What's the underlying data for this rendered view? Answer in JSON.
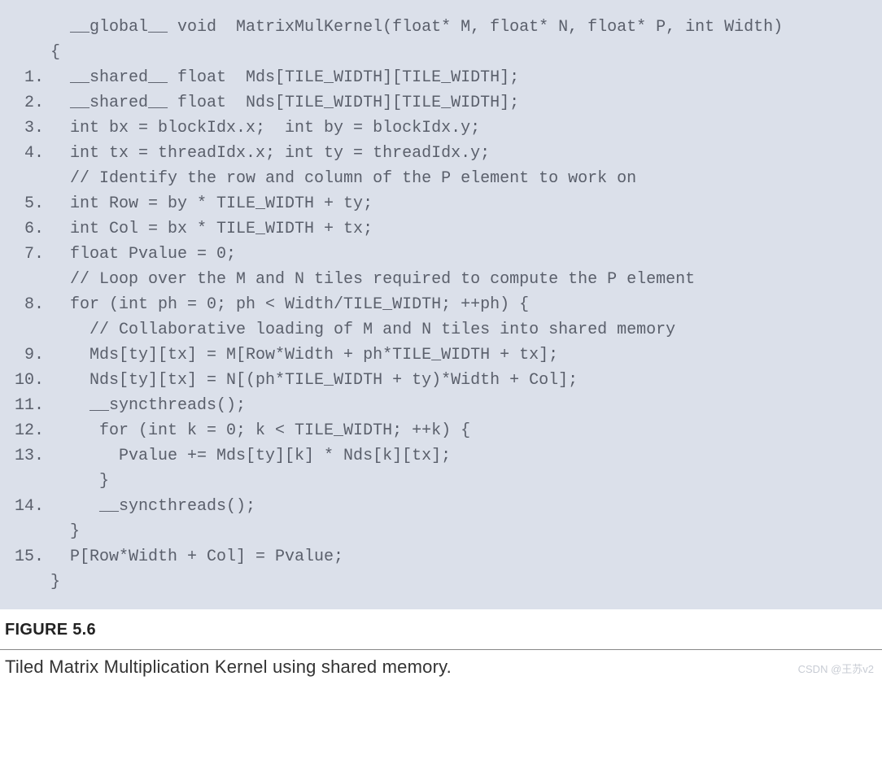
{
  "code": {
    "lines": [
      {
        "num": "",
        "text": "  __global__ void  MatrixMulKernel(float* M, float* N, float* P, int Width)"
      },
      {
        "num": "",
        "text": "{"
      },
      {
        "num": "",
        "text": ""
      },
      {
        "num": "1.",
        "text": "  __shared__ float  Mds[TILE_WIDTH][TILE_WIDTH];"
      },
      {
        "num": "2.",
        "text": "  __shared__ float  Nds[TILE_WIDTH][TILE_WIDTH];"
      },
      {
        "num": "",
        "text": ""
      },
      {
        "num": "3.",
        "text": "  int bx = blockIdx.x;  int by = blockIdx.y;"
      },
      {
        "num": "4.",
        "text": "  int tx = threadIdx.x; int ty = threadIdx.y;"
      },
      {
        "num": "",
        "text": ""
      },
      {
        "num": "",
        "text": "  // Identify the row and column of the P element to work on"
      },
      {
        "num": "5.",
        "text": "  int Row = by * TILE_WIDTH + ty;"
      },
      {
        "num": "6.",
        "text": "  int Col = bx * TILE_WIDTH + tx;"
      },
      {
        "num": "",
        "text": ""
      },
      {
        "num": "7.",
        "text": "  float Pvalue = 0;"
      },
      {
        "num": "",
        "text": "  // Loop over the M and N tiles required to compute the P element"
      },
      {
        "num": "8.",
        "text": "  for (int ph = 0; ph < Width/TILE_WIDTH; ++ph) {"
      },
      {
        "num": "",
        "text": ""
      },
      {
        "num": "",
        "text": "    // Collaborative loading of M and N tiles into shared memory"
      },
      {
        "num": "9.",
        "text": "    Mds[ty][tx] = M[Row*Width + ph*TILE_WIDTH + tx];"
      },
      {
        "num": "10.",
        "text": "    Nds[ty][tx] = N[(ph*TILE_WIDTH + ty)*Width + Col];"
      },
      {
        "num": "11.",
        "text": "    __syncthreads();"
      },
      {
        "num": "",
        "text": ""
      },
      {
        "num": "12.",
        "text": "     for (int k = 0; k < TILE_WIDTH; ++k) {"
      },
      {
        "num": "13.",
        "text": "       Pvalue += Mds[ty][k] * Nds[k][tx];"
      },
      {
        "num": "",
        "text": "     }"
      },
      {
        "num": "14.",
        "text": "     __syncthreads();"
      },
      {
        "num": "",
        "text": "  }"
      },
      {
        "num": "15.",
        "text": "  P[Row*Width + Col] = Pvalue;"
      },
      {
        "num": "",
        "text": "}"
      }
    ]
  },
  "figure_label": "FIGURE 5.6",
  "caption": "Tiled Matrix Multiplication Kernel using shared memory.",
  "watermark": "CSDN @王苏v2"
}
